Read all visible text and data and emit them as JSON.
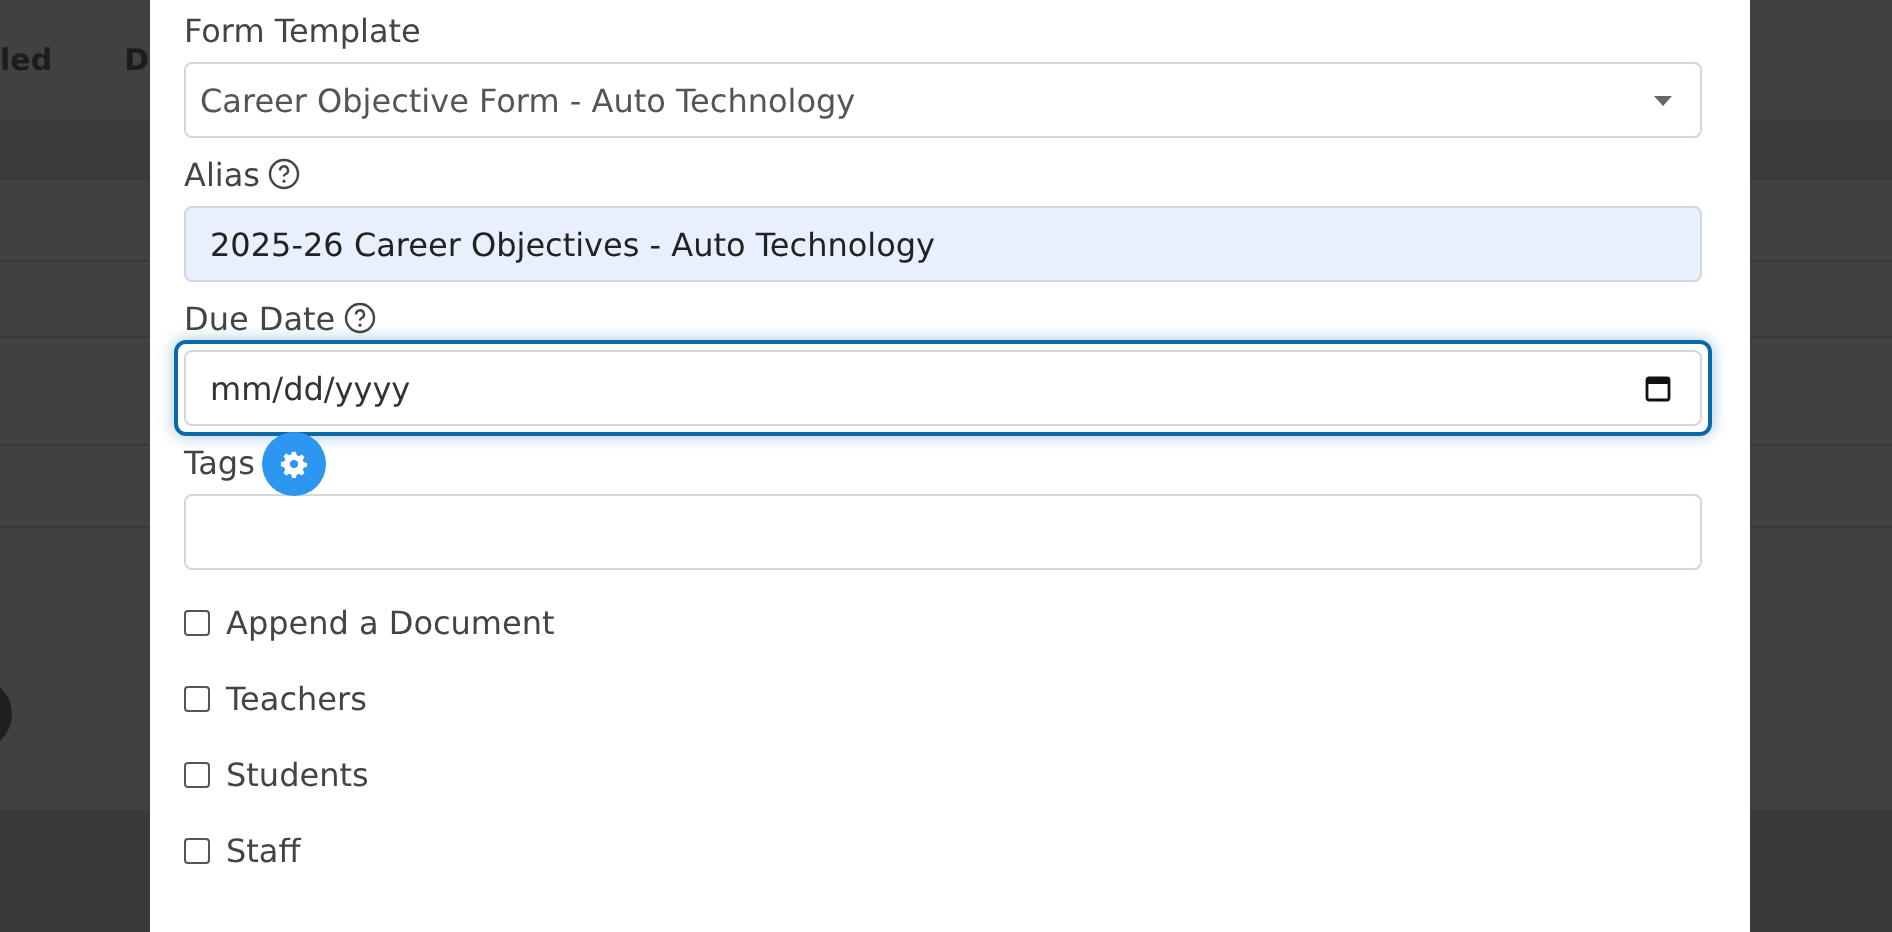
{
  "background": {
    "headers": [
      "led",
      "D"
    ]
  },
  "modal": {
    "fields": [
      {
        "kind": "select",
        "label": "Form Template",
        "value": "Career Objective Form - Auto Technology"
      },
      {
        "kind": "text",
        "label": "Alias",
        "help": true,
        "autofilled": true,
        "value": "2025-26 Career Objectives - Auto Technology"
      },
      {
        "kind": "date",
        "label": "Due Date",
        "help": true,
        "focused": true,
        "placeholder": "mm/dd/yyyy"
      },
      {
        "kind": "tags",
        "label": "Tags"
      }
    ],
    "checkboxes": [
      {
        "label": "Append a Document",
        "checked": false
      },
      {
        "label": "Teachers",
        "checked": false
      },
      {
        "label": "Students",
        "checked": false
      },
      {
        "label": "Staff",
        "checked": false
      }
    ]
  }
}
